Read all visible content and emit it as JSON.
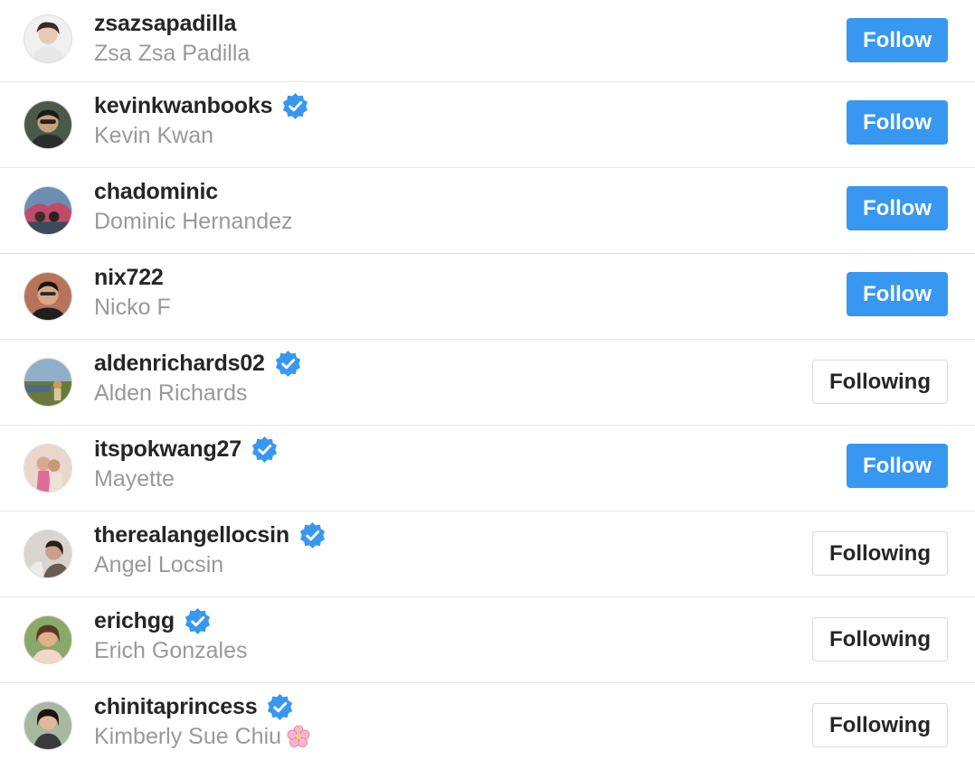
{
  "colors": {
    "follow_bg": "#3897f0",
    "verified_badge": "#3897f0",
    "username": "#262626",
    "fullname": "#999999",
    "divider": "#e6e6e6"
  },
  "users": [
    {
      "username": "zsazsapadilla",
      "full_name": "Zsa Zsa Padilla",
      "verified": false,
      "button_label": "Follow",
      "button_state": "follow",
      "avatar_icon": "avatar-zsazsapadilla"
    },
    {
      "username": "kevinkwanbooks",
      "full_name": "Kevin Kwan",
      "verified": true,
      "button_label": "Follow",
      "button_state": "follow",
      "avatar_icon": "avatar-kevinkwanbooks"
    },
    {
      "username": "chadominic",
      "full_name": "Dominic Hernandez",
      "verified": false,
      "button_label": "Follow",
      "button_state": "follow",
      "avatar_icon": "avatar-chadominic"
    },
    {
      "username": "nix722",
      "full_name": "Nicko F",
      "verified": false,
      "button_label": "Follow",
      "button_state": "follow",
      "avatar_icon": "avatar-nix722"
    },
    {
      "username": "aldenrichards02",
      "full_name": "Alden Richards",
      "verified": true,
      "button_label": "Following",
      "button_state": "following",
      "avatar_icon": "avatar-aldenrichards02"
    },
    {
      "username": "itspokwang27",
      "full_name": "Mayette",
      "verified": true,
      "button_label": "Follow",
      "button_state": "follow",
      "avatar_icon": "avatar-itspokwang27"
    },
    {
      "username": "therealangellocsin",
      "full_name": "Angel Locsin",
      "verified": true,
      "button_label": "Following",
      "button_state": "following",
      "avatar_icon": "avatar-therealangellocsin"
    },
    {
      "username": "erichgg",
      "full_name": "Erich Gonzales",
      "verified": true,
      "button_label": "Following",
      "button_state": "following",
      "avatar_icon": "avatar-erichgg"
    },
    {
      "username": "chinitaprincess",
      "full_name": "Kimberly Sue Chiu",
      "full_name_emoji": "cherry-blossom-icon",
      "verified": true,
      "button_label": "Following",
      "button_state": "following",
      "avatar_icon": "avatar-chinitaprincess"
    }
  ]
}
